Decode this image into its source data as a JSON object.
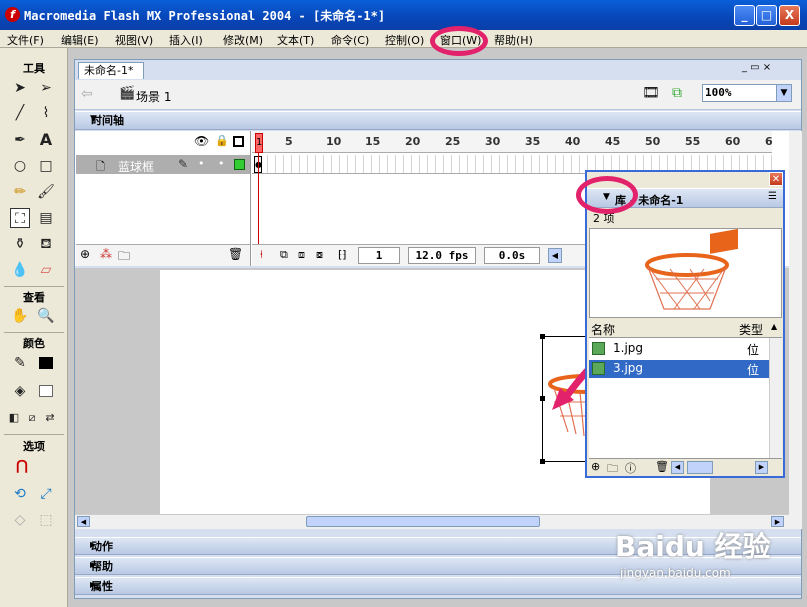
{
  "window": {
    "title": "Macromedia Flash MX Professional 2004 - [未命名-1*]",
    "icon": "flash-app-icon",
    "controls": {
      "minimize": "_",
      "maximize": "□",
      "close": "X"
    }
  },
  "menu": [
    {
      "label": "文件(F)"
    },
    {
      "label": "编辑(E)"
    },
    {
      "label": "视图(V)"
    },
    {
      "label": "插入(I)"
    },
    {
      "label": "修改(M)"
    },
    {
      "label": "文本(T)"
    },
    {
      "label": "命令(C)"
    },
    {
      "label": "控制(O)"
    },
    {
      "label": "窗口(W)"
    },
    {
      "label": "帮助(H)"
    }
  ],
  "tools": {
    "title": "工具",
    "view_title": "查看",
    "colors_title": "颜色",
    "options_title": "选项"
  },
  "document": {
    "tab": "未命名-1*",
    "tab_controls": "_ ▭ ×",
    "scene": "场景 1",
    "zoom": "100%"
  },
  "timeline": {
    "title": "时间轴",
    "frame_numbers": [
      "1",
      "5",
      "10",
      "15",
      "20",
      "25",
      "30",
      "35",
      "40",
      "45",
      "50",
      "55",
      "60",
      "6"
    ],
    "layer": {
      "name": "蓝球框"
    },
    "playhead": "1",
    "status": {
      "frame": "1",
      "fps": "12.0 fps",
      "time": "0.0s"
    }
  },
  "library": {
    "title": "库 - 未命名-1",
    "count": "2 项",
    "columns": {
      "name": "名称",
      "type": "类型"
    },
    "items": [
      {
        "name": "1.jpg",
        "type": "位图",
        "selected": false
      },
      {
        "name": "3.jpg",
        "type": "位图",
        "selected": true
      }
    ]
  },
  "panels": [
    {
      "label": "动作"
    },
    {
      "label": "帮助"
    },
    {
      "label": "属性"
    }
  ],
  "watermark": {
    "brand": "Baidu 经验",
    "url": "jingyan.baidu.com"
  },
  "colors": {
    "annotation": "#e2226a",
    "title_bar": "#0a5fd8",
    "selection": "#3169c6"
  }
}
